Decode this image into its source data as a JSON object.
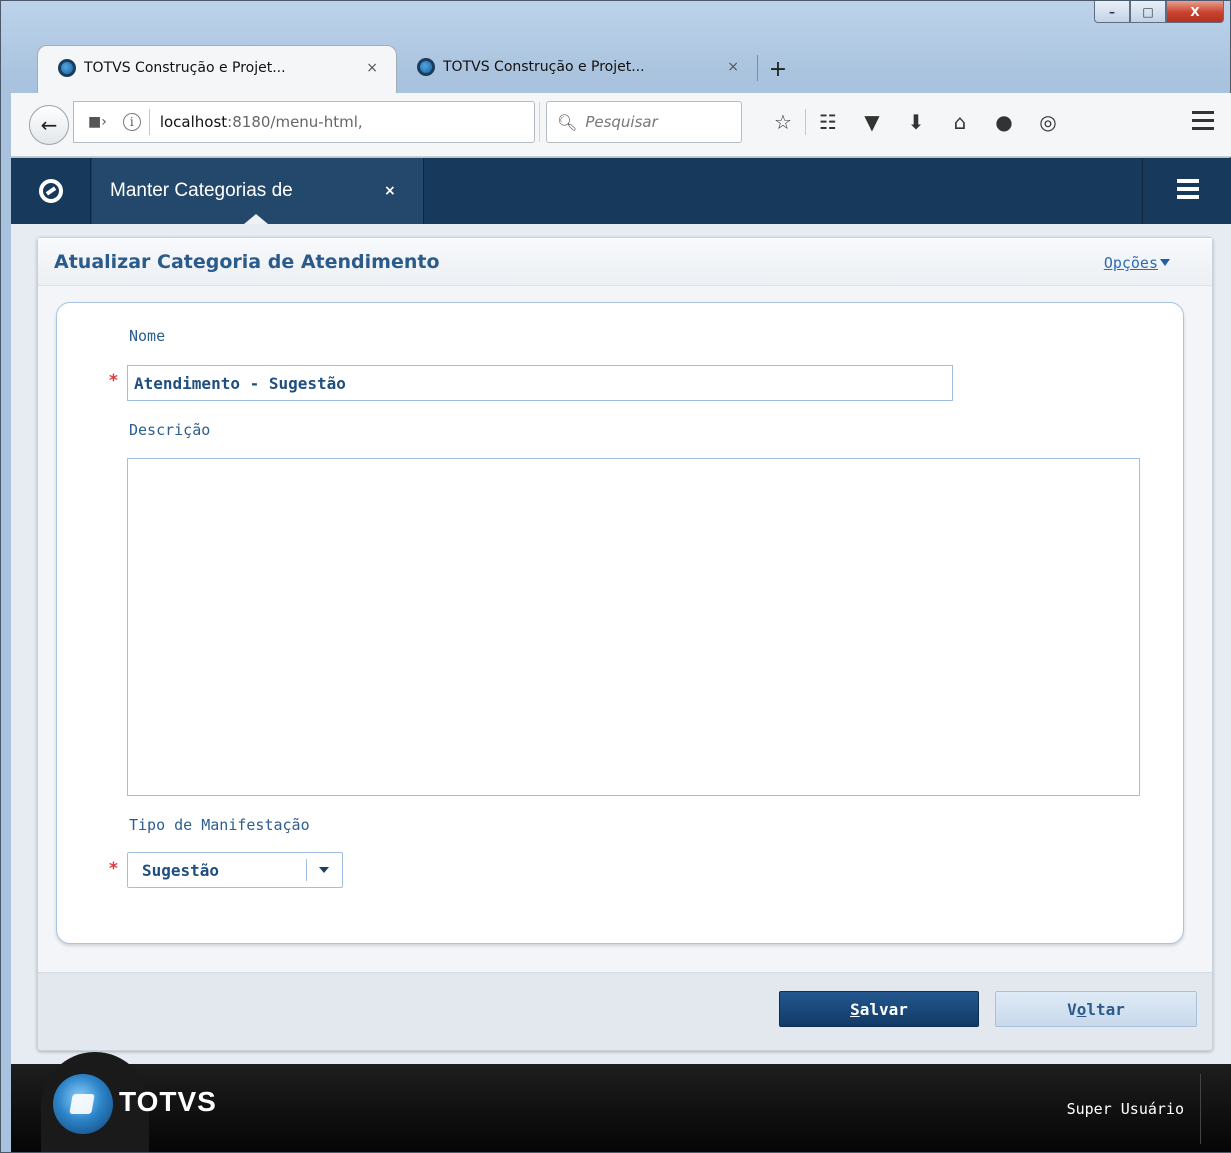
{
  "window": {
    "min": "–",
    "max": "□",
    "close": "X"
  },
  "browser": {
    "tabs": [
      {
        "title": "TOTVS Construção e Projet...",
        "close": "×"
      },
      {
        "title": "TOTVS Construção e Projet...",
        "close": "×"
      }
    ],
    "new_tab": "+",
    "url_host": "localhost",
    "url_path": ":8180/menu-html,",
    "search_placeholder": "Pesquisar",
    "icons": [
      "star-icon",
      "reader-icon",
      "pocket-icon",
      "download-icon",
      "home-icon",
      "chat-icon",
      "globe-icon",
      "menu-icon"
    ]
  },
  "app": {
    "tab_label": "Manter Categorias de",
    "tab_close": "×"
  },
  "form": {
    "title": "Atualizar Categoria de Atendimento",
    "options_label": "Opções",
    "required_mark": "*",
    "nome_label": "Nome",
    "nome_value": "Atendimento - Sugestão",
    "descricao_label": "Descrição",
    "descricao_value": "",
    "tipo_label": "Tipo de Manifestação",
    "tipo_value": "Sugestão",
    "save_key": "S",
    "save_rest": "alvar",
    "back_pre": "V",
    "back_key": "o",
    "back_rest": "ltar"
  },
  "footer": {
    "brand": "TOTVS",
    "user": "Super Usuário"
  },
  "colors": {
    "appbar": "#17395b",
    "title_blue": "#2a5b8a",
    "required_red": "#e03b3b",
    "primary_button": "#113a66"
  }
}
